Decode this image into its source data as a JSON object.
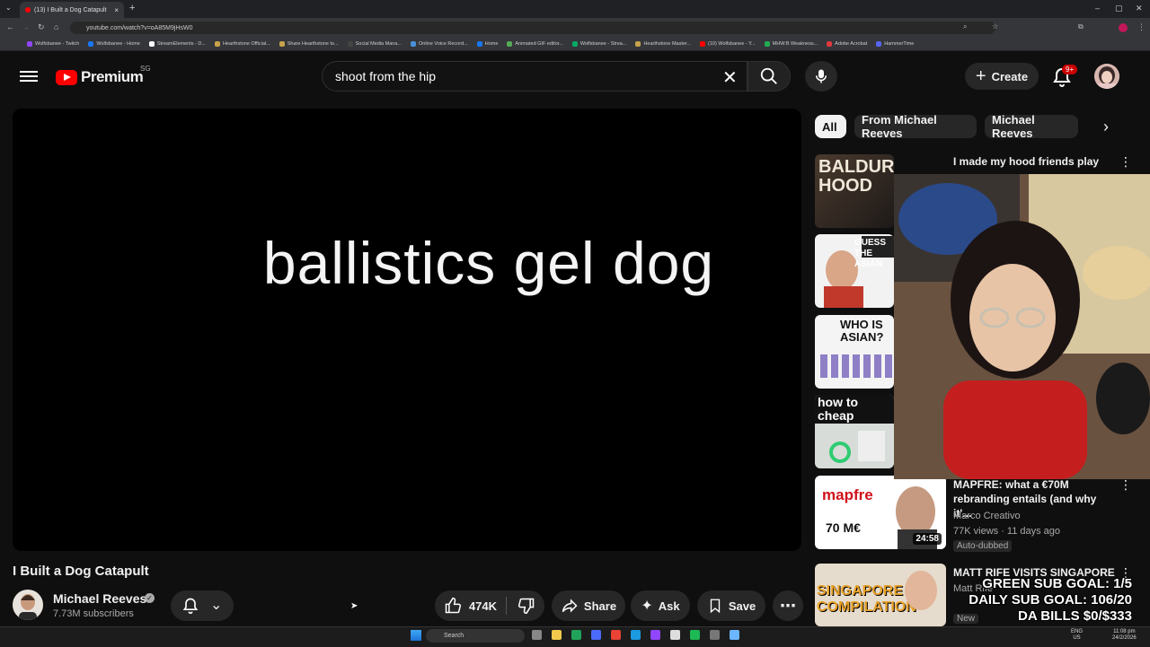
{
  "browser": {
    "tab_title": "(13) I Built a Dog Catapult",
    "url": "youtube.com/watch?v=oA85M9jHsW0",
    "bookmarks": [
      "Wolfsbanee - Twitch",
      "Wolfsbanee - Home",
      "StreamElements - D...",
      "Hearthstone Official...",
      "Share Hearthstone to...",
      "Social Media Mana...",
      "Online Voice Record...",
      "Home",
      "Animated GIF editor...",
      "Wolfsbanee - Strea...",
      "Hearthstone Master...",
      "(10) Wolfsbanee - Y...",
      "MHW:B Weakness...",
      "Adobe Acrobat",
      "HammerTime"
    ],
    "bookmark_colors": [
      "#9146ff",
      "#1877f2",
      "#ffffff",
      "#c8a24a",
      "#c8a24a",
      "#444444",
      "#4a90d9",
      "#1877f2",
      "#55aa55",
      "#00aa66",
      "#c8a24a",
      "#ff0000",
      "#22aa55",
      "#e0383e",
      "#5865f2"
    ]
  },
  "header": {
    "logo_text": "Premium",
    "region": "SG",
    "search_value": "shoot from the hip",
    "create_label": "Create",
    "notif_count": "9+"
  },
  "video": {
    "frame_text": "ballistics gel dog",
    "title": "I Built a Dog Catapult",
    "channel": "Michael Reeves",
    "subscribers": "7.73M subscribers",
    "likes": "474K",
    "share_label": "Share",
    "ask_label": "Ask",
    "save_label": "Save"
  },
  "chips": [
    "All",
    "From Michael Reeves",
    "Michael Reeves"
  ],
  "recommendations": [
    {
      "title": "I made my hood friends play Baldur's Gate 3",
      "thumb_text": "BALDUR'S HOOD"
    },
    {
      "title": "",
      "thumb_text": "GUESS THE ASIAN"
    },
    {
      "title": "",
      "thumb_text": "WHO IS ASIAN?"
    },
    {
      "title": "",
      "thumb_text": "how to cheap"
    },
    {
      "title": "MAPFRE: what a €70M rebranding entails (and why it'...",
      "channel": "Marco Creativo",
      "meta": "77K views · 11 days ago",
      "badge": "Auto-dubbed",
      "duration": "24:58",
      "thumb_text": "mapfre",
      "thumb_sub": "70 M€"
    },
    {
      "title": "MATT RIFE VISITS SINGAPORE",
      "channel": "Matt Rife",
      "badge": "New",
      "thumb_text": "SINGAPORE COMPILATION"
    }
  ],
  "overlay": {
    "goal_lines": [
      "GREEN SUB GOAL: 1/5",
      "DAILY SUB GOAL: 106/20",
      "DA BILLS $0/$333"
    ]
  },
  "taskbar": {
    "search_label": "Search",
    "lang": "ENG",
    "locale": "US",
    "time": "11:08 pm",
    "date": "24/2/2026",
    "app_colors": [
      "#888888",
      "#f2c94c",
      "#20a45a",
      "#4b6bfb",
      "#ea4335",
      "#1b9ae0",
      "#9146ff",
      "#dddddd",
      "#1db954",
      "#777777",
      "#6cb6ff"
    ]
  }
}
